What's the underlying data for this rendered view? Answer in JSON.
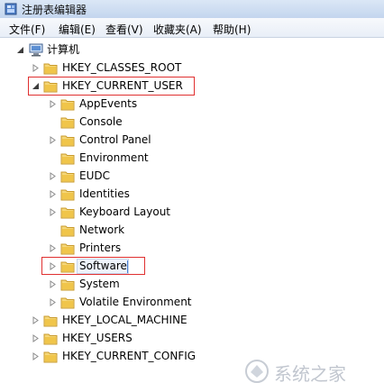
{
  "window": {
    "title": "注册表编辑器",
    "icon": "regedit-icon"
  },
  "menu": [
    {
      "label": "文件(F)"
    },
    {
      "label": "编辑(E)"
    },
    {
      "label": "查看(V)"
    },
    {
      "label": "收藏夹(A)"
    },
    {
      "label": "帮助(H)"
    }
  ],
  "tree": {
    "root": {
      "label": "计算机",
      "icon": "computer-icon",
      "expanded": true
    },
    "hives": [
      {
        "label": "HKEY_CLASSES_ROOT",
        "expanded": false
      },
      {
        "label": "HKEY_CURRENT_USER",
        "expanded": true,
        "highlighted": true
      },
      {
        "label": "HKEY_LOCAL_MACHINE",
        "expanded": false
      },
      {
        "label": "HKEY_USERS",
        "expanded": false
      },
      {
        "label": "HKEY_CURRENT_CONFIG",
        "expanded": false
      }
    ],
    "current_user_children": [
      {
        "label": "AppEvents"
      },
      {
        "label": "Console"
      },
      {
        "label": "Control Panel"
      },
      {
        "label": "Environment"
      },
      {
        "label": "EUDC"
      },
      {
        "label": "Identities"
      },
      {
        "label": "Keyboard Layout"
      },
      {
        "label": "Network"
      },
      {
        "label": "Printers"
      },
      {
        "label": "Software",
        "highlighted": true,
        "editing": true
      },
      {
        "label": "System"
      },
      {
        "label": "Volatile Environment"
      }
    ]
  },
  "watermark": {
    "text": "系统之家",
    "icon": "watermark-logo-icon"
  },
  "colors": {
    "highlight_border": "#e03030",
    "folder": "#f0c54a"
  }
}
